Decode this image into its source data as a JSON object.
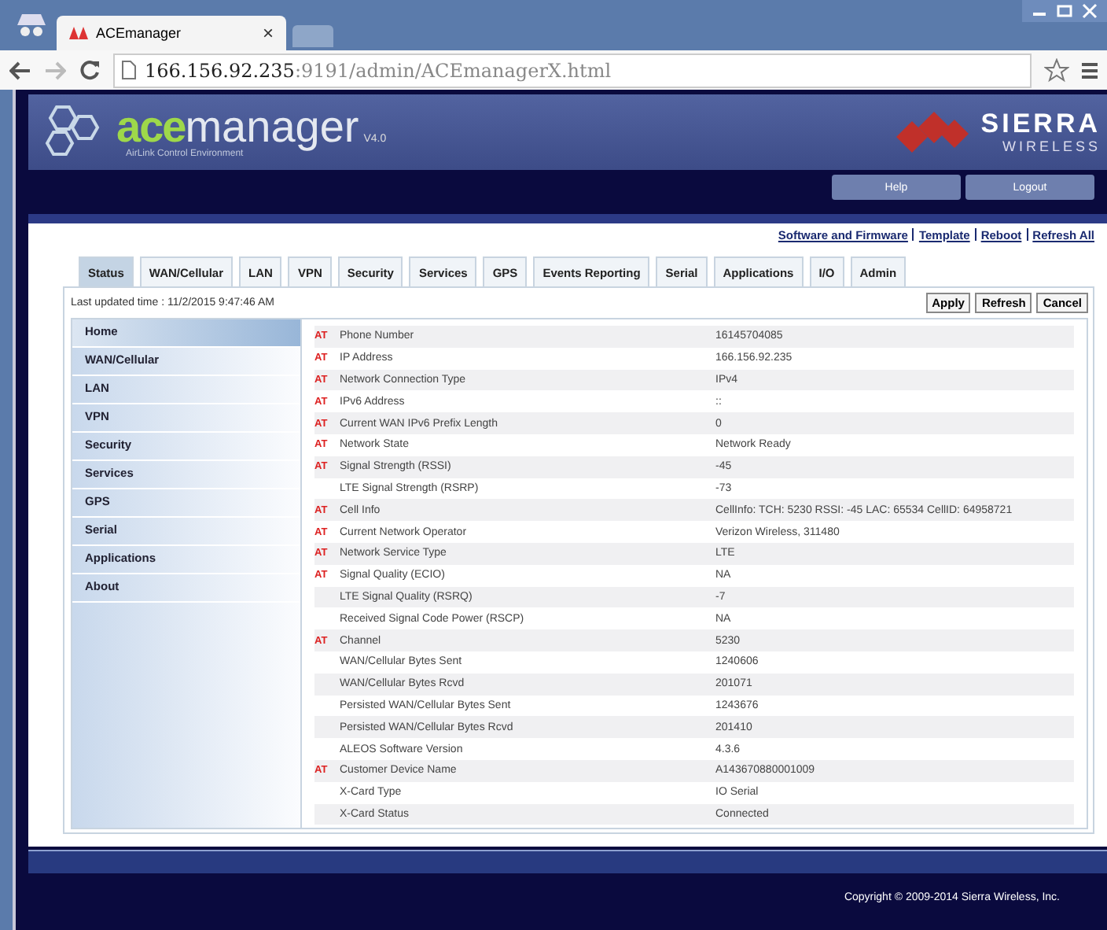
{
  "browser": {
    "tab_title": "ACEmanager",
    "tab_close": "×",
    "url_host": "166.156.92.235",
    "url_path": ":9191/admin/ACEmanagerX.html"
  },
  "header": {
    "logo": "ace",
    "logo_rest": "manager",
    "version": "V4.0",
    "tagline": "AirLink Control Environment",
    "brand": "SIERRA",
    "brand_sub": "WIRELESS"
  },
  "top_buttons": [
    "Help",
    "Logout"
  ],
  "links": [
    "Software and Firmware",
    "Template",
    "Reboot",
    "Refresh All"
  ],
  "tabs": [
    {
      "label": "Status",
      "selected": true
    },
    {
      "label": "WAN/Cellular",
      "selected": false
    },
    {
      "label": "LAN",
      "selected": false
    },
    {
      "label": "VPN",
      "selected": false
    },
    {
      "label": "Security",
      "selected": false
    },
    {
      "label": "Services",
      "selected": false
    },
    {
      "label": "GPS",
      "selected": false
    },
    {
      "label": "Events Reporting",
      "selected": false
    },
    {
      "label": "Serial",
      "selected": false
    },
    {
      "label": "Applications",
      "selected": false
    },
    {
      "label": "I/O",
      "selected": false
    },
    {
      "label": "Admin",
      "selected": false
    }
  ],
  "last_updated": "Last updated time : 11/2/2015 9:47:46 AM",
  "actions": [
    "Apply",
    "Refresh",
    "Cancel"
  ],
  "sidebar": {
    "items": [
      {
        "label": "Home",
        "selected": true
      },
      {
        "label": "WAN/Cellular",
        "selected": false
      },
      {
        "label": "LAN",
        "selected": false
      },
      {
        "label": "VPN",
        "selected": false
      },
      {
        "label": "Security",
        "selected": false
      },
      {
        "label": "Services",
        "selected": false
      },
      {
        "label": "GPS",
        "selected": false
      },
      {
        "label": "Serial",
        "selected": false
      },
      {
        "label": "Applications",
        "selected": false
      },
      {
        "label": "About",
        "selected": false
      }
    ]
  },
  "rows": [
    {
      "badge": "AT",
      "label": "Phone Number",
      "value": "16145704085"
    },
    {
      "badge": "AT",
      "label": "IP Address",
      "value": "166.156.92.235"
    },
    {
      "badge": "AT",
      "label": "Network Connection Type",
      "value": "IPv4"
    },
    {
      "badge": "AT",
      "label": "IPv6 Address",
      "value": "::"
    },
    {
      "badge": "AT",
      "label": "Current WAN IPv6 Prefix Length",
      "value": "0"
    },
    {
      "badge": "AT",
      "label": "Network State",
      "value": "Network Ready"
    },
    {
      "badge": "AT",
      "label": "Signal Strength (RSSI)",
      "value": "-45"
    },
    {
      "label": "LTE Signal Strength (RSRP)",
      "value": "-73"
    },
    {
      "badge": "AT",
      "label": "Cell Info",
      "value": "CellInfo: TCH: 5230 RSSI: -45 LAC: 65534 CellID: 64958721"
    },
    {
      "badge": "AT",
      "label": "Current Network Operator",
      "value": "Verizon Wireless, 311480"
    },
    {
      "badge": "AT",
      "label": "Network Service Type",
      "value": "LTE"
    },
    {
      "badge": "AT",
      "label": "Signal Quality (ECIO)",
      "value": "NA"
    },
    {
      "label": "LTE Signal Quality (RSRQ)",
      "value": "-7"
    },
    {
      "label": "Received Signal Code Power (RSCP)",
      "value": "NA"
    },
    {
      "badge": "AT",
      "label": "Channel",
      "value": "5230"
    },
    {
      "label": "WAN/Cellular Bytes Sent",
      "value": "1240606"
    },
    {
      "label": "WAN/Cellular Bytes Rcvd",
      "value": "201071"
    },
    {
      "label": "Persisted WAN/Cellular Bytes Sent",
      "value": "1243676"
    },
    {
      "label": "Persisted WAN/Cellular Bytes Rcvd",
      "value": "201410"
    },
    {
      "label": "ALEOS Software Version",
      "value": "4.3.6"
    },
    {
      "badge": "AT",
      "label": "Customer Device Name",
      "value": "A143670880001009"
    },
    {
      "label": "X-Card Type",
      "value": "IO Serial"
    },
    {
      "label": "X-Card Status",
      "value": "Connected"
    }
  ],
  "footer": "Copyright © 2009-2014 Sierra Wireless, Inc."
}
